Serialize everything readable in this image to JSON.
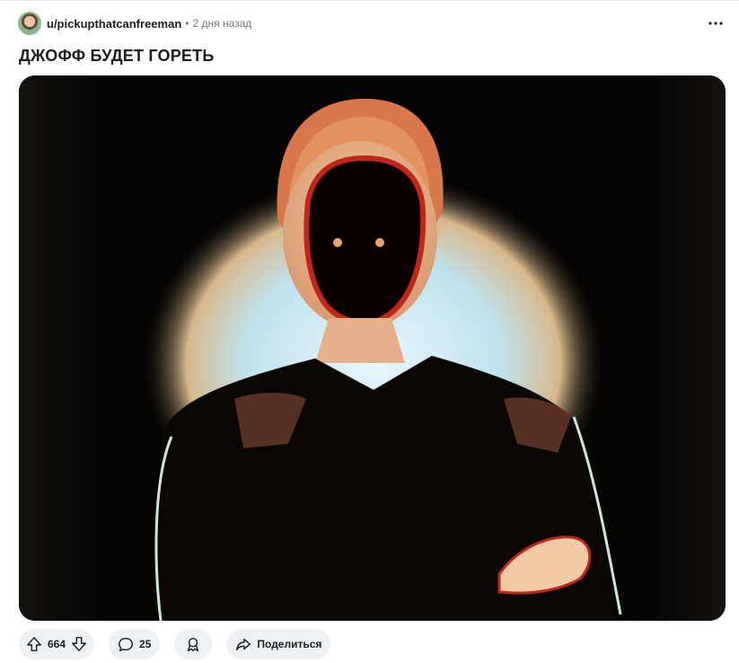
{
  "post": {
    "username": "u/pickupthatcanfreeman",
    "separator": "•",
    "time": "2 дня назад",
    "title": "ДЖОФФ БУДЕТ ГОРЕТЬ"
  },
  "icons": {
    "avatar": "user-avatar",
    "more": "more-dots-icon",
    "upvote": "upvote-arrow-icon",
    "downvote": "downvote-arrow-icon",
    "comment": "comment-bubble-icon",
    "award": "award-ribbon-icon",
    "share": "share-arrow-icon"
  },
  "actions": {
    "vote_count": "664",
    "comment_count": "25",
    "share_label": "Поделиться"
  },
  "colors": {
    "pill_bg": "#eef1f3",
    "text": "#1c1c1c",
    "meta": "#6f7780"
  }
}
